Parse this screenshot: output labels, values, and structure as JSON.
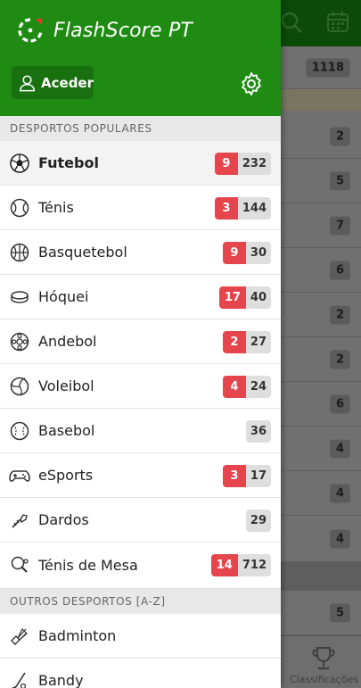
{
  "app": {
    "brand": "FlashScore PT",
    "login_label": "Aceder"
  },
  "colors": {
    "brand_green": "#1f8b12",
    "live_red": "#e5454d",
    "count_grey": "#dedede"
  },
  "sections": {
    "popular_title": "DESPORTOS POPULARES",
    "other_title": "OUTROS DESPORTOS [A-Z]"
  },
  "popular_sports": [
    {
      "name": "Futebol",
      "icon": "soccer-ball-icon",
      "live": "9",
      "total": "232",
      "active": true
    },
    {
      "name": "Ténis",
      "icon": "tennis-ball-icon",
      "live": "3",
      "total": "144"
    },
    {
      "name": "Basquetebol",
      "icon": "basketball-icon",
      "live": "9",
      "total": "30"
    },
    {
      "name": "Hóquei",
      "icon": "hockey-puck-icon",
      "live": "17",
      "total": "40"
    },
    {
      "name": "Andebol",
      "icon": "handball-icon",
      "live": "2",
      "total": "27"
    },
    {
      "name": "Voleibol",
      "icon": "volleyball-icon",
      "live": "4",
      "total": "24"
    },
    {
      "name": "Basebol",
      "icon": "baseball-icon",
      "live": "",
      "total": "36"
    },
    {
      "name": "eSports",
      "icon": "gamepad-icon",
      "live": "3",
      "total": "17"
    },
    {
      "name": "Dardos",
      "icon": "dart-icon",
      "live": "",
      "total": "29"
    },
    {
      "name": "Ténis de Mesa",
      "icon": "table-tennis-icon",
      "live": "14",
      "total": "712"
    }
  ],
  "other_sports": [
    {
      "name": "Badminton",
      "icon": "shuttlecock-icon"
    },
    {
      "name": "Bandy",
      "icon": "bandy-stick-icon"
    }
  ],
  "background": {
    "counts": [
      "1118",
      "2",
      "5",
      "7",
      "6",
      "2",
      "2",
      "6",
      "4",
      "4",
      "4",
      "5"
    ],
    "bottom_tab_label": "Classificações"
  }
}
